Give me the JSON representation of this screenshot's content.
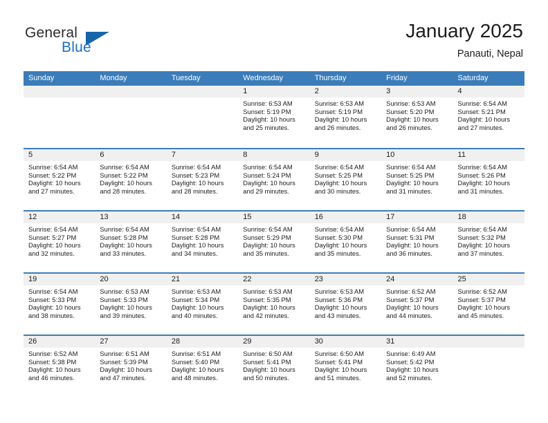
{
  "brand": {
    "line1": "General",
    "line2": "Blue",
    "accent_color": "#1565a8",
    "text_color": "#2b2b2b"
  },
  "header": {
    "title": "January 2025",
    "subtitle": "Panauti, Nepal"
  },
  "calendar": {
    "header_bg": "#3b7cba",
    "daynum_bg": "#f0f0f0",
    "weekdays": [
      "Sunday",
      "Monday",
      "Tuesday",
      "Wednesday",
      "Thursday",
      "Friday",
      "Saturday"
    ],
    "weeks": [
      [
        {
          "date": "",
          "lines": []
        },
        {
          "date": "",
          "lines": []
        },
        {
          "date": "",
          "lines": []
        },
        {
          "date": "1",
          "lines": [
            "Sunrise: 6:53 AM",
            "Sunset: 5:19 PM",
            "Daylight: 10 hours",
            "and 25 minutes."
          ]
        },
        {
          "date": "2",
          "lines": [
            "Sunrise: 6:53 AM",
            "Sunset: 5:19 PM",
            "Daylight: 10 hours",
            "and 26 minutes."
          ]
        },
        {
          "date": "3",
          "lines": [
            "Sunrise: 6:53 AM",
            "Sunset: 5:20 PM",
            "Daylight: 10 hours",
            "and 26 minutes."
          ]
        },
        {
          "date": "4",
          "lines": [
            "Sunrise: 6:54 AM",
            "Sunset: 5:21 PM",
            "Daylight: 10 hours",
            "and 27 minutes."
          ]
        }
      ],
      [
        {
          "date": "5",
          "lines": [
            "Sunrise: 6:54 AM",
            "Sunset: 5:22 PM",
            "Daylight: 10 hours",
            "and 27 minutes."
          ]
        },
        {
          "date": "6",
          "lines": [
            "Sunrise: 6:54 AM",
            "Sunset: 5:22 PM",
            "Daylight: 10 hours",
            "and 28 minutes."
          ]
        },
        {
          "date": "7",
          "lines": [
            "Sunrise: 6:54 AM",
            "Sunset: 5:23 PM",
            "Daylight: 10 hours",
            "and 28 minutes."
          ]
        },
        {
          "date": "8",
          "lines": [
            "Sunrise: 6:54 AM",
            "Sunset: 5:24 PM",
            "Daylight: 10 hours",
            "and 29 minutes."
          ]
        },
        {
          "date": "9",
          "lines": [
            "Sunrise: 6:54 AM",
            "Sunset: 5:25 PM",
            "Daylight: 10 hours",
            "and 30 minutes."
          ]
        },
        {
          "date": "10",
          "lines": [
            "Sunrise: 6:54 AM",
            "Sunset: 5:25 PM",
            "Daylight: 10 hours",
            "and 31 minutes."
          ]
        },
        {
          "date": "11",
          "lines": [
            "Sunrise: 6:54 AM",
            "Sunset: 5:26 PM",
            "Daylight: 10 hours",
            "and 31 minutes."
          ]
        }
      ],
      [
        {
          "date": "12",
          "lines": [
            "Sunrise: 6:54 AM",
            "Sunset: 5:27 PM",
            "Daylight: 10 hours",
            "and 32 minutes."
          ]
        },
        {
          "date": "13",
          "lines": [
            "Sunrise: 6:54 AM",
            "Sunset: 5:28 PM",
            "Daylight: 10 hours",
            "and 33 minutes."
          ]
        },
        {
          "date": "14",
          "lines": [
            "Sunrise: 6:54 AM",
            "Sunset: 5:28 PM",
            "Daylight: 10 hours",
            "and 34 minutes."
          ]
        },
        {
          "date": "15",
          "lines": [
            "Sunrise: 6:54 AM",
            "Sunset: 5:29 PM",
            "Daylight: 10 hours",
            "and 35 minutes."
          ]
        },
        {
          "date": "16",
          "lines": [
            "Sunrise: 6:54 AM",
            "Sunset: 5:30 PM",
            "Daylight: 10 hours",
            "and 35 minutes."
          ]
        },
        {
          "date": "17",
          "lines": [
            "Sunrise: 6:54 AM",
            "Sunset: 5:31 PM",
            "Daylight: 10 hours",
            "and 36 minutes."
          ]
        },
        {
          "date": "18",
          "lines": [
            "Sunrise: 6:54 AM",
            "Sunset: 5:32 PM",
            "Daylight: 10 hours",
            "and 37 minutes."
          ]
        }
      ],
      [
        {
          "date": "19",
          "lines": [
            "Sunrise: 6:54 AM",
            "Sunset: 5:33 PM",
            "Daylight: 10 hours",
            "and 38 minutes."
          ]
        },
        {
          "date": "20",
          "lines": [
            "Sunrise: 6:53 AM",
            "Sunset: 5:33 PM",
            "Daylight: 10 hours",
            "and 39 minutes."
          ]
        },
        {
          "date": "21",
          "lines": [
            "Sunrise: 6:53 AM",
            "Sunset: 5:34 PM",
            "Daylight: 10 hours",
            "and 40 minutes."
          ]
        },
        {
          "date": "22",
          "lines": [
            "Sunrise: 6:53 AM",
            "Sunset: 5:35 PM",
            "Daylight: 10 hours",
            "and 42 minutes."
          ]
        },
        {
          "date": "23",
          "lines": [
            "Sunrise: 6:53 AM",
            "Sunset: 5:36 PM",
            "Daylight: 10 hours",
            "and 43 minutes."
          ]
        },
        {
          "date": "24",
          "lines": [
            "Sunrise: 6:52 AM",
            "Sunset: 5:37 PM",
            "Daylight: 10 hours",
            "and 44 minutes."
          ]
        },
        {
          "date": "25",
          "lines": [
            "Sunrise: 6:52 AM",
            "Sunset: 5:37 PM",
            "Daylight: 10 hours",
            "and 45 minutes."
          ]
        }
      ],
      [
        {
          "date": "26",
          "lines": [
            "Sunrise: 6:52 AM",
            "Sunset: 5:38 PM",
            "Daylight: 10 hours",
            "and 46 minutes."
          ]
        },
        {
          "date": "27",
          "lines": [
            "Sunrise: 6:51 AM",
            "Sunset: 5:39 PM",
            "Daylight: 10 hours",
            "and 47 minutes."
          ]
        },
        {
          "date": "28",
          "lines": [
            "Sunrise: 6:51 AM",
            "Sunset: 5:40 PM",
            "Daylight: 10 hours",
            "and 48 minutes."
          ]
        },
        {
          "date": "29",
          "lines": [
            "Sunrise: 6:50 AM",
            "Sunset: 5:41 PM",
            "Daylight: 10 hours",
            "and 50 minutes."
          ]
        },
        {
          "date": "30",
          "lines": [
            "Sunrise: 6:50 AM",
            "Sunset: 5:41 PM",
            "Daylight: 10 hours",
            "and 51 minutes."
          ]
        },
        {
          "date": "31",
          "lines": [
            "Sunrise: 6:49 AM",
            "Sunset: 5:42 PM",
            "Daylight: 10 hours",
            "and 52 minutes."
          ]
        },
        {
          "date": "",
          "lines": []
        }
      ]
    ]
  }
}
